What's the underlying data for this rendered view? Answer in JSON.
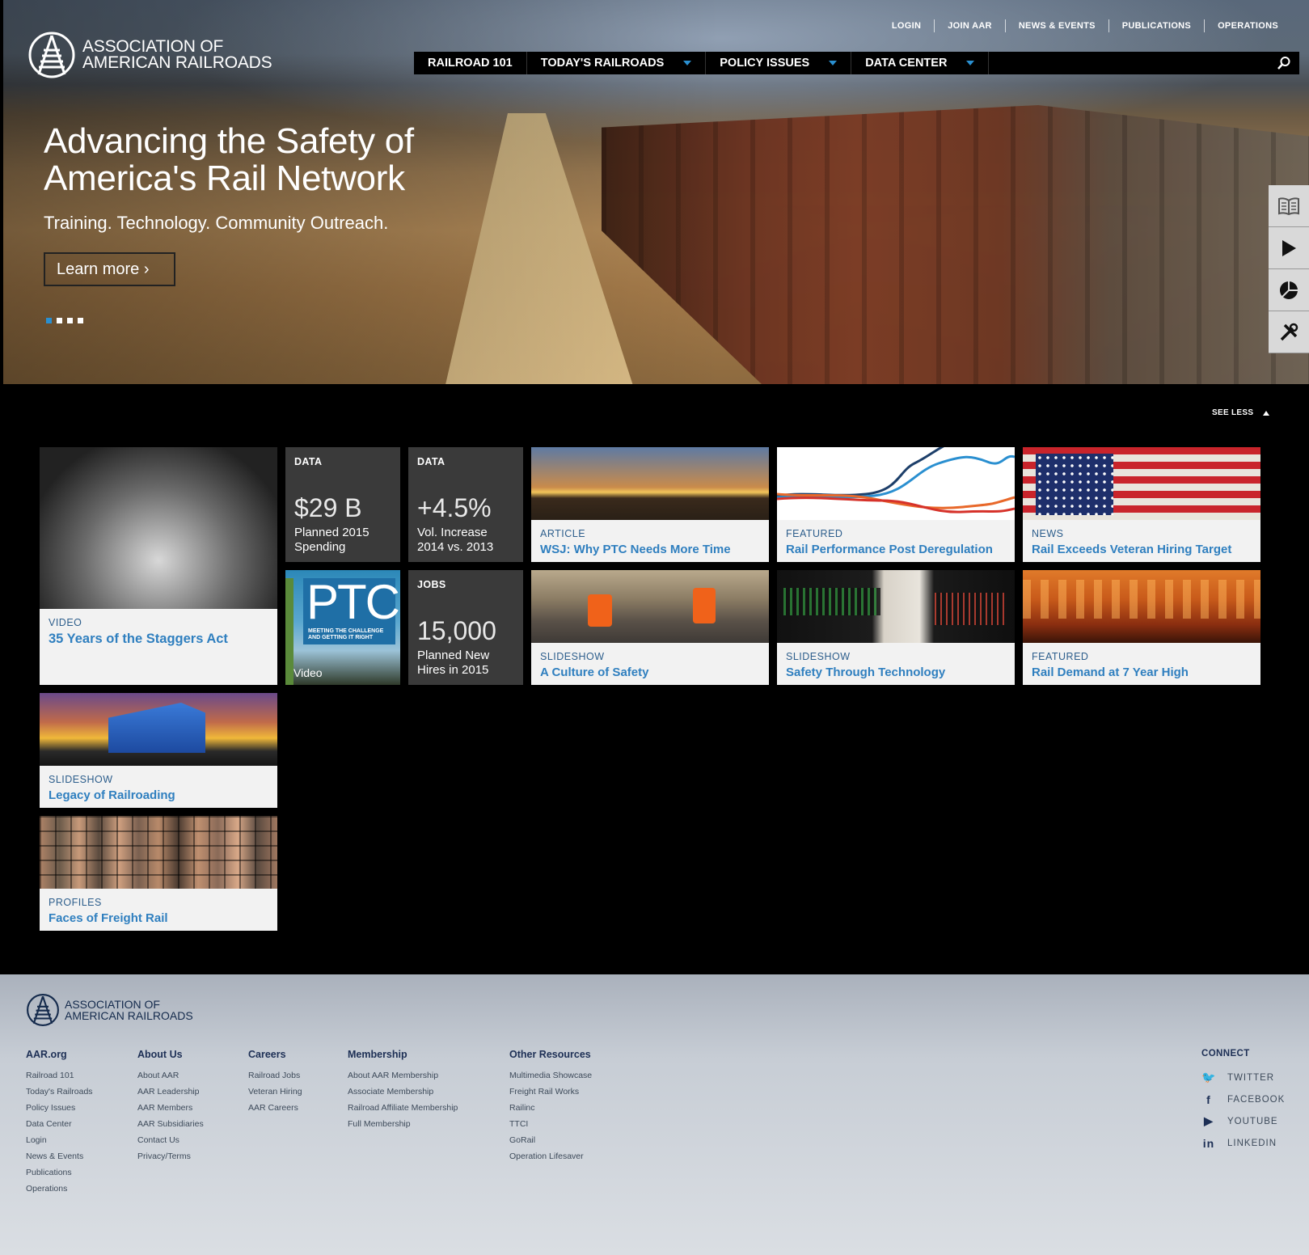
{
  "site": {
    "logo_line1": "ASSOCIATION OF",
    "logo_line2": "AMERICAN RAILROADS"
  },
  "utility_nav": [
    "LOGIN",
    "JOIN AAR",
    "NEWS & EVENTS",
    "PUBLICATIONS",
    "OPERATIONS"
  ],
  "main_nav": [
    {
      "label": "RAILROAD 101",
      "dropdown": false
    },
    {
      "label": "TODAY'S RAILROADS",
      "dropdown": true
    },
    {
      "label": "POLICY ISSUES",
      "dropdown": true
    },
    {
      "label": "DATA CENTER",
      "dropdown": true
    }
  ],
  "hero": {
    "title": "Advancing the Safety of America's Rail Network",
    "subtitle": "Training. Technology. Community Outreach.",
    "cta": "Learn more ›",
    "slide_count": 4,
    "active_slide": 1
  },
  "side_tools": [
    "book-icon",
    "play-icon",
    "pie-chart-icon",
    "tools-icon"
  ],
  "tiles": {
    "see_less": "SEE LESS",
    "staggers": {
      "category": "VIDEO",
      "title": "35 Years of the Staggers Act"
    },
    "data1": {
      "label": "DATA",
      "value": "$29 B",
      "desc1": "Planned 2015",
      "desc2": "Spending"
    },
    "data2": {
      "label": "DATA",
      "value": "+4.5%",
      "desc1": "Vol. Increase",
      "desc2": "2014 vs. 2013"
    },
    "wsj": {
      "category": "ARTICLE",
      "title": "WSJ: Why PTC Needs More Time"
    },
    "deregulation": {
      "category": "FEATURED",
      "title": "Rail Performance Post Deregulation"
    },
    "veteran": {
      "category": "NEWS",
      "title": "Rail Exceeds Veteran Hiring Target"
    },
    "ptc": {
      "title": "PTC",
      "tagline1": "MEETING THE CHALLENGE",
      "tagline2": "AND GETTING IT RIGHT",
      "label": "Video"
    },
    "jobs": {
      "label": "JOBS",
      "value": "15,000",
      "desc1": "Planned New",
      "desc2": "Hires in 2015"
    },
    "culture": {
      "category": "SLIDESHOW",
      "title": "A Culture of Safety"
    },
    "technology": {
      "category": "SLIDESHOW",
      "title": "Safety Through Technology"
    },
    "demand": {
      "category": "FEATURED",
      "title": "Rail Demand at 7 Year High"
    },
    "legacy": {
      "category": "SLIDESHOW",
      "title": "Legacy of Railroading"
    },
    "faces": {
      "category": "PROFILES",
      "title": "Faces of Freight Rail"
    }
  },
  "footer": {
    "logo_line1": "ASSOCIATION OF",
    "logo_line2": "AMERICAN RAILROADS",
    "columns": [
      {
        "heading": "AAR.org",
        "links": [
          "Railroad 101",
          "Today's Railroads",
          "Policy Issues",
          "Data Center",
          "Login",
          "News & Events",
          "Publications",
          "Operations"
        ]
      },
      {
        "heading": "About Us",
        "links": [
          "About AAR",
          "AAR Leadership",
          "AAR Members",
          "AAR Subsidiaries",
          "Contact Us",
          "Privacy/Terms"
        ]
      },
      {
        "heading": "Careers",
        "links": [
          "Railroad Jobs",
          "Veteran Hiring",
          "AAR Careers"
        ]
      },
      {
        "heading": "Membership",
        "links": [
          "About AAR Membership",
          "Associate Membership",
          "Railroad Affiliate Membership",
          "Full Membership"
        ]
      },
      {
        "heading": "Other Resources",
        "links": [
          "Multimedia Showcase",
          "Freight Rail Works",
          "Railinc",
          "TTCI",
          "GoRail",
          "Operation Lifesaver"
        ]
      }
    ],
    "connect": {
      "heading": "CONNECT",
      "items": [
        {
          "icon": "twitter-icon",
          "glyph": "🐦",
          "label": "TWITTER"
        },
        {
          "icon": "facebook-icon",
          "glyph": "f",
          "label": "FACEBOOK"
        },
        {
          "icon": "youtube-icon",
          "glyph": "▶",
          "label": "YOUTUBE"
        },
        {
          "icon": "linkedin-icon",
          "glyph": "in",
          "label": "LINKEDIN"
        }
      ]
    }
  },
  "colors": {
    "accent": "#2a8fd0",
    "link_title": "#2f7fbf",
    "stat_bg": "#3a3a3a",
    "caption_bg": "#f2f2f2"
  }
}
